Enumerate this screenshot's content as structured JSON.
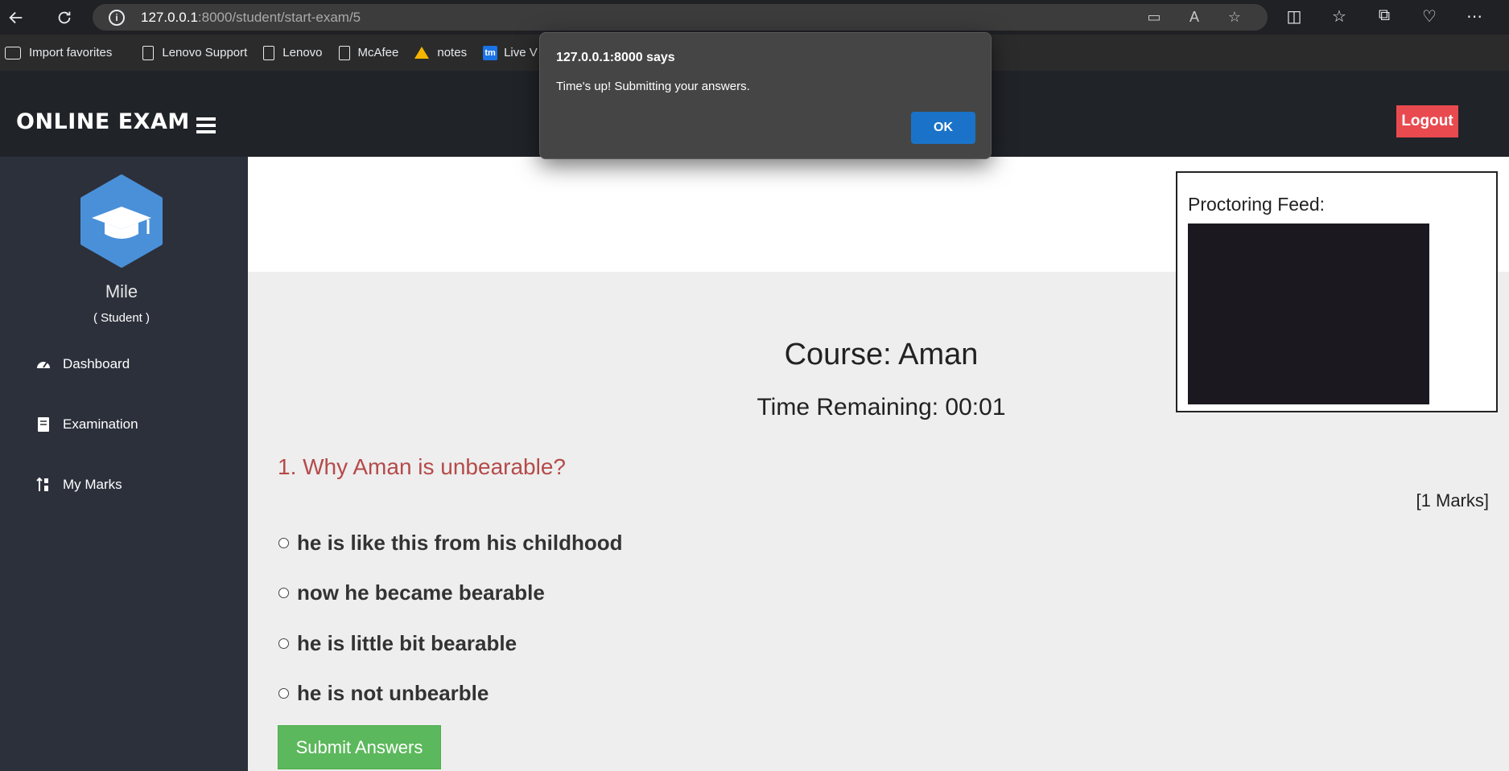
{
  "browser": {
    "url_host": "127.0.0.1",
    "url_path": ":8000/student/start-exam/5",
    "bookmarks": [
      {
        "label": "Import favorites",
        "icon": "import-icon"
      },
      {
        "label": "Lenovo Support",
        "icon": "page-icon"
      },
      {
        "label": "Lenovo",
        "icon": "page-icon"
      },
      {
        "label": "McAfee",
        "icon": "page-icon"
      },
      {
        "label": "notes",
        "icon": "google-drive-icon"
      },
      {
        "label": "Live V",
        "icon": "tm-icon"
      }
    ]
  },
  "header": {
    "brand": "ONLINE EXAM",
    "logout_label": "Logout",
    "logout_color": "#e84a4f"
  },
  "sidebar": {
    "user_name": "Mile",
    "user_role": "( Student )",
    "items": [
      {
        "label": "Dashboard",
        "icon": "dashboard-gauge-icon"
      },
      {
        "label": "Examination",
        "icon": "book-icon"
      },
      {
        "label": "My Marks",
        "icon": "sort-numeric-icon"
      }
    ]
  },
  "exam": {
    "course": "Course: Aman",
    "timer": "Time Remaining: 00:01",
    "question": "1. Why Aman is unbearable?",
    "marks": "[1 Marks]",
    "options": [
      "he is like this from his childhood",
      "now he became bearable",
      "he is little bit bearable",
      "he is not unbearble"
    ],
    "submit_label": "Submit Answers",
    "submit_color": "#5cb85c",
    "proctor_label": "Proctoring Feed:"
  },
  "dialog": {
    "title": "127.0.0.1:8000 says",
    "message": "Time's up! Submitting your answers.",
    "ok_label": "OK",
    "ok_color": "#1a73c8"
  }
}
